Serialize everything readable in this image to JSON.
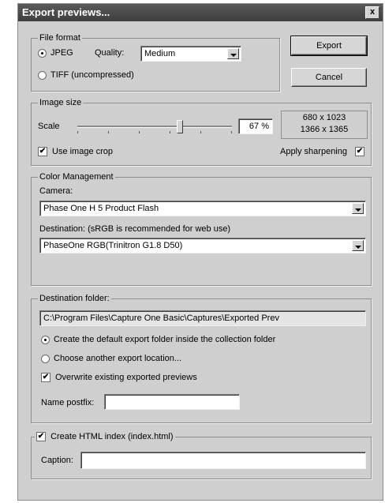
{
  "window": {
    "title": "Export previews...",
    "close_label": "x"
  },
  "file_format": {
    "legend": "File format",
    "jpeg_label": "JPEG",
    "quality_label": "Quality:",
    "quality_value": "Medium",
    "tiff_label": "TIFF (uncompressed)",
    "jpeg_selected": true
  },
  "buttons": {
    "export_label": "Export",
    "cancel_label": "Cancel"
  },
  "image_size": {
    "legend": "Image size",
    "scale_label": "Scale",
    "scale_value": "67 %",
    "scale_fraction": 0.67,
    "size_line1": "680 x 1023",
    "size_line2": "1366 x 1365",
    "use_crop_label": "Use image crop",
    "use_crop_checked": true,
    "sharpening_label": "Apply sharpening",
    "sharpening_checked": true
  },
  "color_management": {
    "legend": "Color Management",
    "camera_label": "Camera:",
    "camera_value": "Phase One H 5  Product Flash",
    "destination_label": "Destination: (sRGB is recommended for web use)",
    "destination_value": "PhaseOne RGB(Trinitron G1.8 D50)"
  },
  "destination_folder": {
    "legend": "Destination folder:",
    "path": "C:\\Program Files\\Capture One Basic\\Captures\\Exported Prev",
    "option_default": "Create the default export folder inside the collection folder",
    "option_other": "Choose another export location...",
    "default_selected": true,
    "overwrite_label": "Overwrite existing exported previews",
    "overwrite_checked": true,
    "postfix_label": "Name postfix:",
    "postfix_value": ""
  },
  "html_index": {
    "legend": "Create HTML index (index.html)",
    "checked": true,
    "caption_label": "Caption:",
    "caption_value": ""
  },
  "check_glyph": "✔"
}
